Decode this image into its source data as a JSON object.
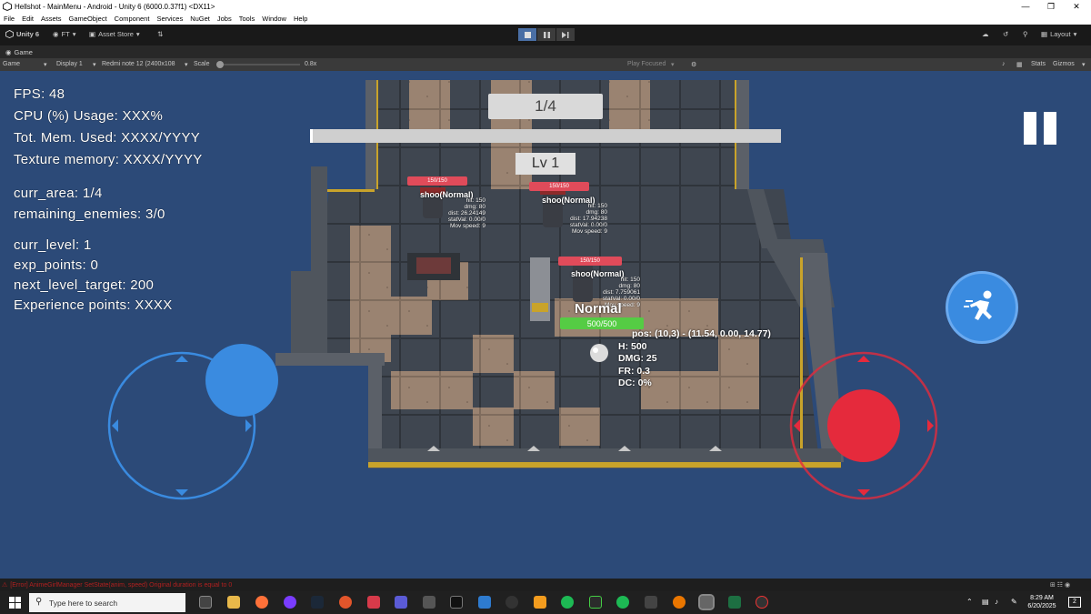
{
  "window": {
    "title": "Hellshot - MainMenu - Android - Unity 6 (6000.0.37f1) <DX11>",
    "minimize_icon": "minimize-icon",
    "restore_icon": "restore-icon",
    "close_icon": "close-icon"
  },
  "menubar": {
    "items": [
      "File",
      "Edit",
      "Assets",
      "GameObject",
      "Component",
      "Services",
      "NuGet",
      "Jobs",
      "Tools",
      "Window",
      "Help"
    ]
  },
  "toolbar": {
    "unity_label": "Unity 6",
    "account_label": "FT",
    "asset_store_label": "Asset Store",
    "layout_label": "Layout",
    "play_state": "playing"
  },
  "game_tab": {
    "tab_label": "Game",
    "view_select": "Game",
    "display_select": "Display 1",
    "resolution_select": "Redmi note 12 (2400x108",
    "scale_label": "Scale",
    "scale_value": "0.8x",
    "play_focused": "Play Focused",
    "stats_label": "Stats",
    "gizmos_label": "Gizmos"
  },
  "hud": {
    "fps": "FPS: 48",
    "cpu": "CPU (%) Usage: XXX%",
    "total_memory": "Tot. Mem. Used: XXXX/YYYY",
    "texture_memory": "Texture memory: XXXX/YYYY",
    "curr_area": "curr_area: 1/4",
    "remaining_enemies": "remaining_enemies: 3/0",
    "curr_level": "curr_level: 1",
    "exp_points": "exp_points: 0",
    "next_level_target": "next_level_target: 200",
    "experience_points": "Experience points: XXXX",
    "area_counter": "1/4",
    "level_badge": "Lv 1"
  },
  "enemies": [
    {
      "hp_label": "150/150",
      "hp_fraction": 1.0,
      "name": "shoo(Normal)",
      "stats": [
        "hit: 150",
        "dmg: 80",
        "dist: 26.24149",
        "statVal: 0.00/0",
        "Mov speed: 9"
      ]
    },
    {
      "hp_label": "150/150",
      "hp_fraction": 1.0,
      "name": "shoo(Normal)",
      "stats": [
        "hit: 150",
        "dmg: 80",
        "dist: 17.94238",
        "statVal: 0.00/0",
        "Mov speed: 9"
      ]
    },
    {
      "hp_label": "150/150",
      "hp_fraction": 1.0,
      "name": "shoo(Normal)",
      "stats": [
        "hit: 150",
        "dmg: 80",
        "dist: 7.759061",
        "statVal: 0.00/0",
        "Mov speed: 9"
      ]
    }
  ],
  "player": {
    "mode": "Normal",
    "hp_label": "500/500",
    "hp_fraction": 1.0,
    "pos": "pos: (10,3) - (11.54, 0.00, 14.77)",
    "h": "H: 500",
    "dmg": "DMG: 25",
    "fr": "FR: 0.3",
    "dc": "DC: 0%"
  },
  "controls": {
    "pause_icon": "pause-icon",
    "dash_icon": "running-man-icon",
    "move_joystick": "move-joystick",
    "aim_joystick": "aim-joystick"
  },
  "console": {
    "error_text": "[Error] AnimeGirlManager SetState(anim, speed) Original duration is equal to 0"
  },
  "taskbar": {
    "search_placeholder": "Type here to search",
    "time": "8:29 AM",
    "date": "6/20/2025",
    "notification_count": "2"
  },
  "colors": {
    "game_bg": "#2c4a78",
    "joystick_blue": "#3a8be0",
    "joystick_red": "#e52a3c",
    "hp_red": "#e04b5a",
    "hp_green": "#55cc44"
  }
}
